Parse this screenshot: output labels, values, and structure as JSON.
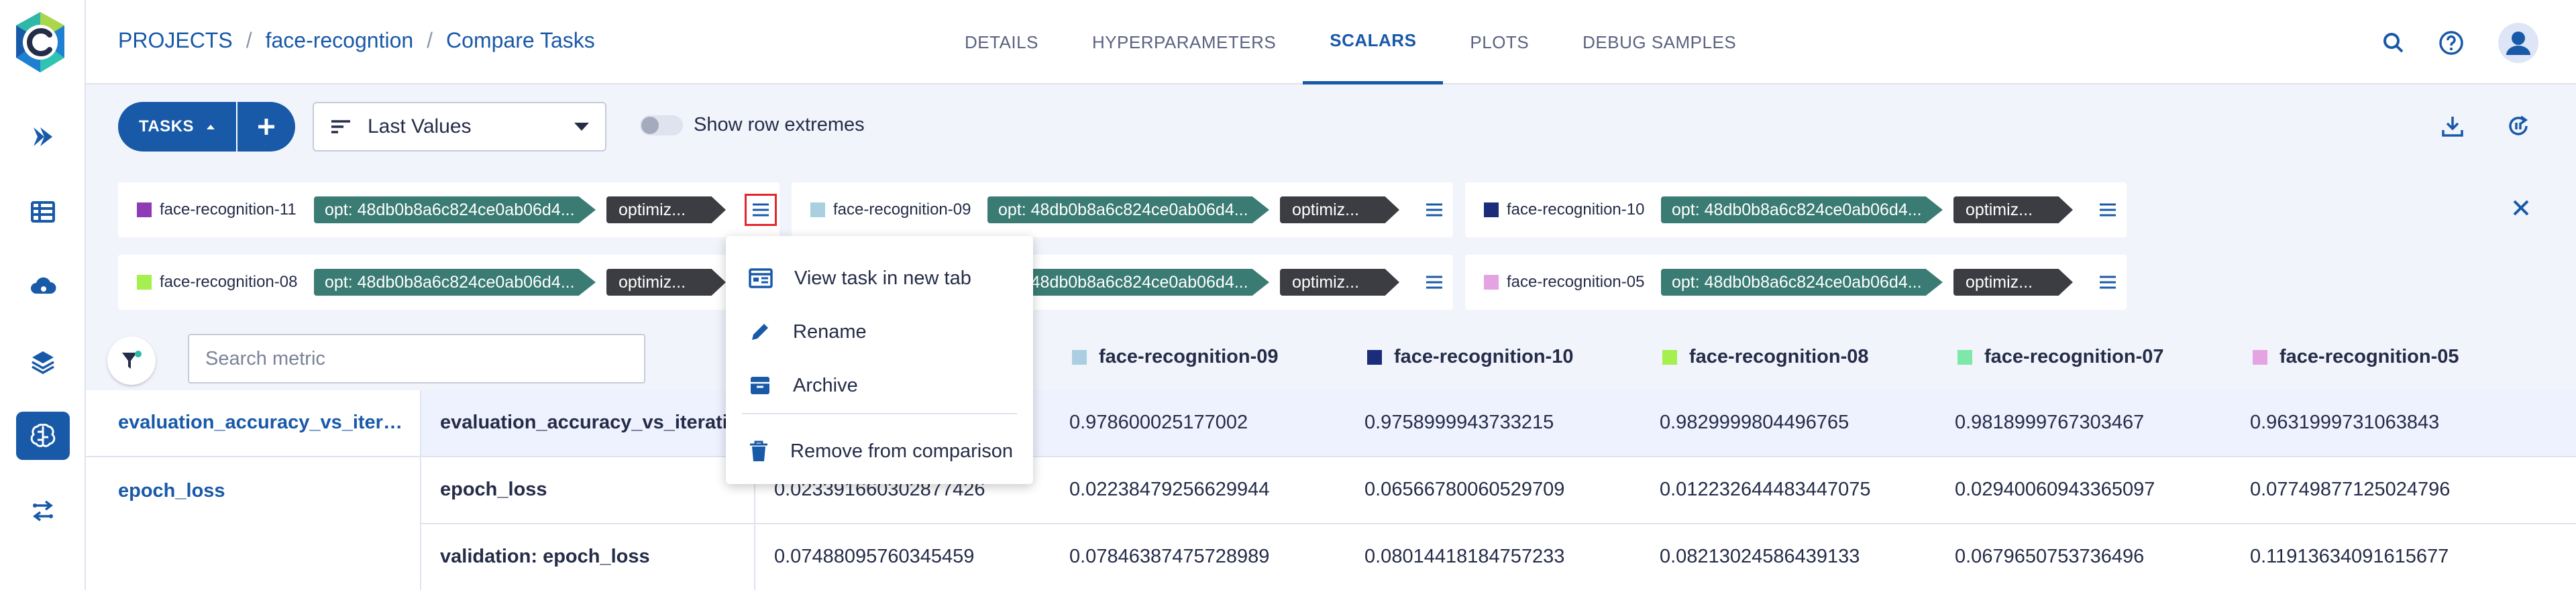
{
  "breadcrumb": {
    "projects": "PROJECTS",
    "sep": "/",
    "project": "face-recogntion",
    "page": "Compare Tasks"
  },
  "tabs": [
    "DETAILS",
    "HYPERPARAMETERS",
    "SCALARS",
    "PLOTS",
    "DEBUG SAMPLES"
  ],
  "active_tab": "SCALARS",
  "toolbar": {
    "tasks_label": "TASKS",
    "value_mode": "Last Values",
    "toggle_label": "Show row extremes"
  },
  "tasks": [
    {
      "name": "face-recognition-11",
      "color": "#8e3bb5",
      "tag1": "opt: 48db0b8a6c824ce0ab06d4...",
      "tag2": "optimiz..."
    },
    {
      "name": "face-recognition-09",
      "color": "#a9cfe0",
      "tag1": "opt: 48db0b8a6c824ce0ab06d4...",
      "tag2": "optimiz..."
    },
    {
      "name": "face-recognition-10",
      "color": "#1b2c7a",
      "tag1": "opt: 48db0b8a6c824ce0ab06d4...",
      "tag2": "optimiz..."
    },
    {
      "name": "face-recognition-08",
      "color": "#a5ef4f",
      "tag1": "opt: 48db0b8a6c824ce0ab06d4...",
      "tag2": "optimiz..."
    },
    {
      "name": "face-recognition-07",
      "color": "#7de8a9",
      "tag1": "opt: 48db0b8a6c824ce0ab06d4...",
      "tag2": "optimiz..."
    },
    {
      "name": "face-recognition-05",
      "color": "#e4a4e2",
      "tag1": "opt: 48db0b8a6c824ce0ab06d4...",
      "tag2": "optimiz..."
    }
  ],
  "search": {
    "placeholder": "Search metric"
  },
  "context_menu": {
    "items": [
      "View task in new tab",
      "Rename",
      "Archive"
    ],
    "danger_item": "Remove from comparison"
  },
  "table": {
    "metrics": [
      "evaluation_accuracy_vs_iteratio...",
      "epoch_loss"
    ],
    "variants": [
      "evaluation_accuracy_vs_iterations",
      "epoch_loss",
      "validation: epoch_loss"
    ],
    "rows": [
      [
        "",
        "0.978600025177002",
        "0.9758999943733215",
        "0.9829999804496765",
        "0.9818999767303467",
        "0.9631999731063843"
      ],
      [
        "0.023391660302877426",
        "0.02238479256629944",
        "0.06566780060529709",
        "0.012232644483447075",
        "0.02940060943365097",
        "0.07749877125024796"
      ],
      [
        "0.07488095760345459",
        "0.07846387475728989",
        "0.08014418184757233",
        "0.08213024586439133",
        "0.0679650753736496",
        "0.11913634091615677"
      ]
    ]
  }
}
